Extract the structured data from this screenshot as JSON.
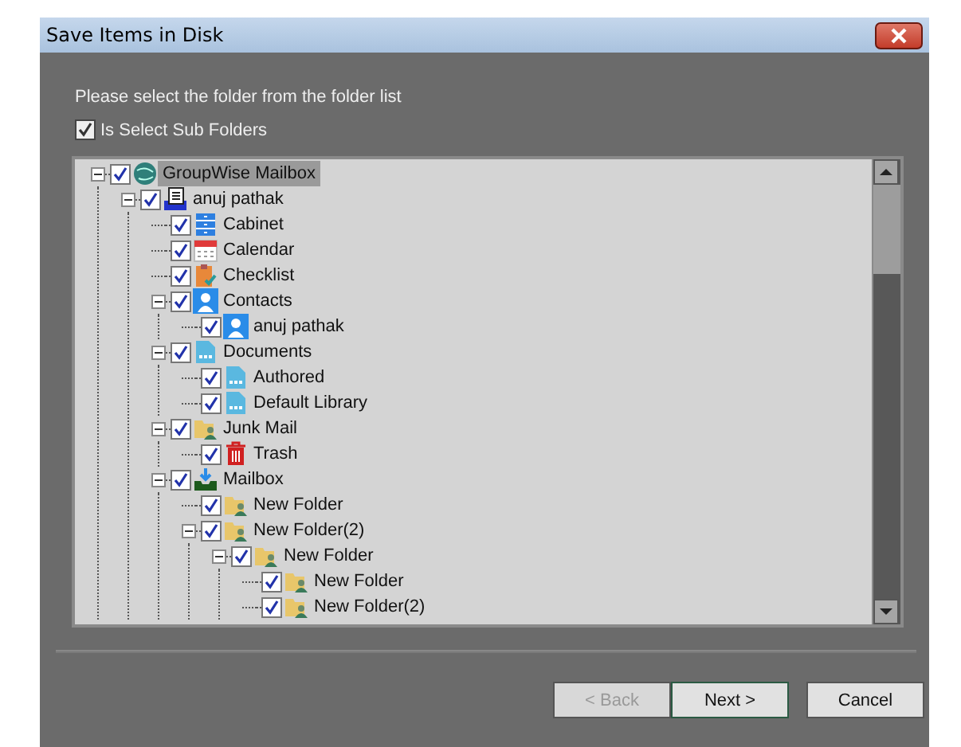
{
  "window": {
    "title": "Save Items in Disk"
  },
  "instruction": "Please select the folder from the folder list",
  "subfolders_option": {
    "label": "Is Select Sub Folders",
    "checked": true
  },
  "tree": [
    {
      "label": "GroupWise Mailbox",
      "kind": "globe",
      "checked": true,
      "selected": true,
      "expanded": true,
      "children": [
        {
          "label": "anuj pathak",
          "kind": "account",
          "checked": true,
          "selected": false,
          "expanded": true,
          "children": [
            {
              "label": "Cabinet",
              "kind": "cabinet",
              "checked": true,
              "selected": false
            },
            {
              "label": "Calendar",
              "kind": "calendar",
              "checked": true,
              "selected": false
            },
            {
              "label": "Checklist",
              "kind": "checklist",
              "checked": true,
              "selected": false
            },
            {
              "label": "Contacts",
              "kind": "contact",
              "checked": true,
              "selected": false,
              "expanded": true,
              "children": [
                {
                  "label": "anuj pathak",
                  "kind": "contact",
                  "checked": true,
                  "selected": false
                }
              ]
            },
            {
              "label": "Documents",
              "kind": "document",
              "checked": true,
              "selected": false,
              "expanded": true,
              "children": [
                {
                  "label": "Authored",
                  "kind": "document",
                  "checked": true,
                  "selected": false
                },
                {
                  "label": "Default Library",
                  "kind": "document",
                  "checked": true,
                  "selected": false
                }
              ]
            },
            {
              "label": "Junk Mail",
              "kind": "folder",
              "checked": true,
              "selected": false,
              "expanded": true,
              "children": [
                {
                  "label": "Trash",
                  "kind": "trash",
                  "checked": true,
                  "selected": false
                }
              ]
            },
            {
              "label": "Mailbox",
              "kind": "inbox",
              "checked": true,
              "selected": false,
              "expanded": true,
              "children": [
                {
                  "label": "New Folder",
                  "kind": "folder",
                  "checked": true,
                  "selected": false
                },
                {
                  "label": "New Folder(2)",
                  "kind": "folder",
                  "checked": true,
                  "selected": false,
                  "expanded": true,
                  "children": [
                    {
                      "label": "New Folder",
                      "kind": "folder",
                      "checked": true,
                      "selected": false,
                      "expanded": true,
                      "children": [
                        {
                          "label": "New Folder",
                          "kind": "folder",
                          "checked": true,
                          "selected": false
                        },
                        {
                          "label": "New Folder(2)",
                          "kind": "folder",
                          "checked": true,
                          "selected": false
                        }
                      ]
                    }
                  ]
                }
              ]
            }
          ]
        }
      ]
    }
  ],
  "buttons": [
    {
      "label": "< Back",
      "disabled": true,
      "default": false
    },
    {
      "label": "Next >",
      "disabled": false,
      "default": true
    },
    {
      "label": "Cancel",
      "disabled": false,
      "default": false
    }
  ]
}
